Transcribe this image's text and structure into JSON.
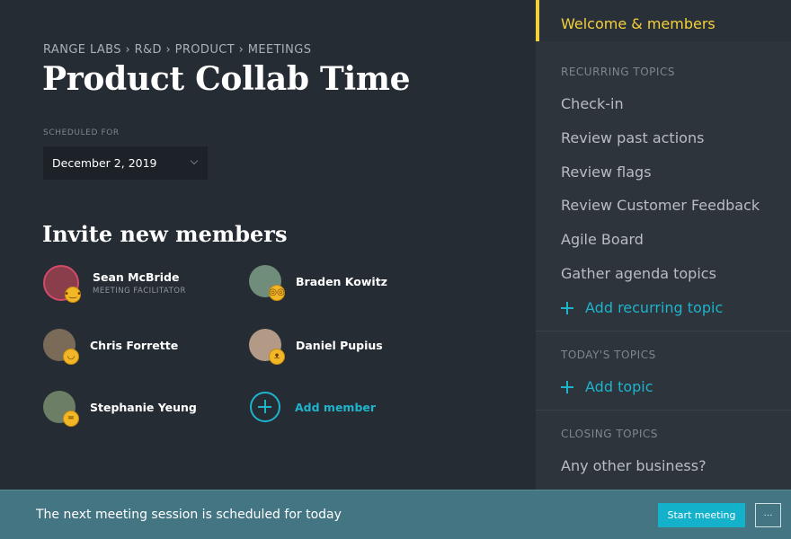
{
  "header": {
    "breadcrumb": "RANGE LABS › R&D › PRODUCT › MEETINGS",
    "title": "Product Collab Time",
    "scheduled_label": "SCHEDULED FOR",
    "scheduled_date": "December 2, 2019"
  },
  "invite": {
    "title": "Invite new members",
    "members": [
      {
        "name": "Sean McBride",
        "role": "MEETING FACILITATOR",
        "avatar_color": "#8a3d4a",
        "emoji": "sleepy-face-icon"
      },
      {
        "name": "Braden Kowitz",
        "role": "",
        "avatar_color": "#6f8d7a",
        "emoji": "nerd-face-icon"
      },
      {
        "name": "Chris Forrette",
        "role": "",
        "avatar_color": "#7a6a58",
        "emoji": "smiling-face-icon"
      },
      {
        "name": "Daniel Pupius",
        "role": "",
        "avatar_color": "#b29a86",
        "emoji": "cat-face-icon"
      },
      {
        "name": "Stephanie Yeung",
        "role": "",
        "avatar_color": "#6d7e66",
        "emoji": "tired-face-icon"
      }
    ],
    "add_member_label": "Add member"
  },
  "sidebar": {
    "active_item": "Welcome & members",
    "recurring_title": "RECURRING TOPICS",
    "recurring": [
      "Check-in",
      "Review past actions",
      "Review flags",
      "Review Customer Feedback",
      "Agile Board",
      "Gather agenda topics"
    ],
    "add_recurring_label": "Add recurring topic",
    "today_title": "TODAY'S TOPICS",
    "add_topic_label": "Add topic",
    "closing_title": "CLOSING TOPICS",
    "closing": [
      "Any other business?"
    ]
  },
  "footer": {
    "message": "The next meeting session is scheduled for today",
    "start_label": "Start meeting",
    "more_label": "···"
  },
  "colors": {
    "accent": "#1fb3cc",
    "active": "#f4d03b",
    "footer_bg": "#447583"
  }
}
